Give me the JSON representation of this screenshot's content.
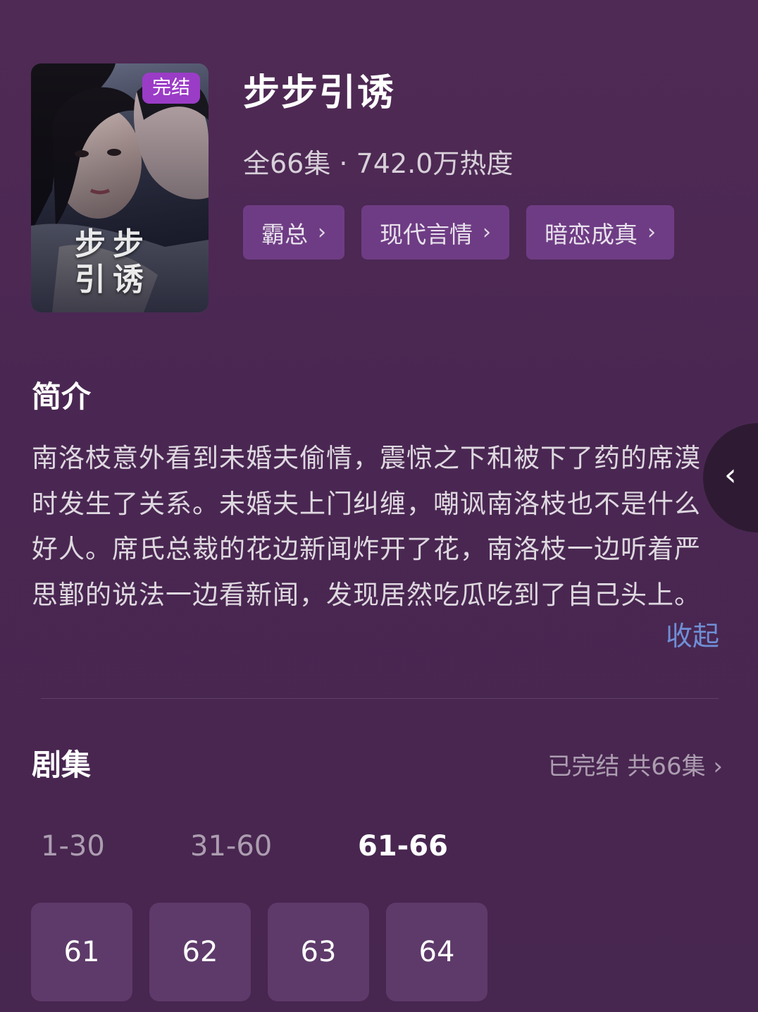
{
  "poster": {
    "badge": "完结",
    "title_art": "步步 引诱"
  },
  "show": {
    "title": "步步引诱",
    "meta": "全66集 · 742.0万热度",
    "tags": [
      {
        "label": "霸总"
      },
      {
        "label": "现代言情"
      },
      {
        "label": "暗恋成真"
      }
    ]
  },
  "synopsis": {
    "heading": "简介",
    "text": "南洛枝意外看到未婚夫偷情，震惊之下和被下了药的席漠时发生了关系。未婚夫上门纠缠，嘲讽南洛枝也不是什么好人。席氏总裁的花边新闻炸开了花，南洛枝一边听着严思鄞的说法一边看新闻，发现居然吃瓜吃到了自己头上。",
    "collapse_label": "收起"
  },
  "episodes": {
    "heading": "剧集",
    "status": "已完结 共66集",
    "ranges": [
      {
        "label": "1-30",
        "active": false
      },
      {
        "label": "31-60",
        "active": false
      },
      {
        "label": "61-66",
        "active": true
      }
    ],
    "items": [
      "61",
      "62",
      "63",
      "64"
    ]
  },
  "icons": {
    "tag_chevron": "chevron-right-icon",
    "side_handle": "chevron-left-icon",
    "status_chevron": "chevron-right-icon"
  },
  "colors": {
    "background": "#4b2853",
    "tag_bg": "#6e3c84",
    "badge_bg": "#9b3cc7",
    "link": "#6f8fd6",
    "episode_bg": "#5e3a6a"
  }
}
